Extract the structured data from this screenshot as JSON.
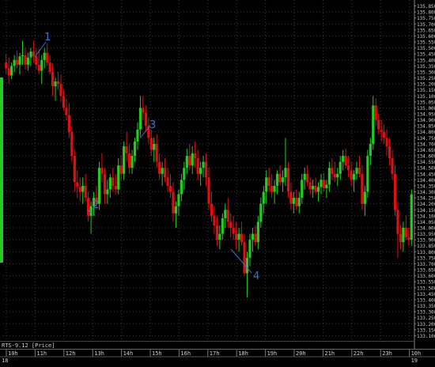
{
  "status_bar": {
    "instrument_label": "RTS-9.12 [Price]"
  },
  "colors": {
    "background": "#000000",
    "bull": "#22cc22",
    "bear": "#dd1111",
    "grid": "#3a3a3a",
    "annotation": "#3377cc",
    "text": "#d0d0d0"
  },
  "annotations": [
    {
      "text": "1"
    },
    {
      "text": "2"
    },
    {
      "text": "3"
    },
    {
      "text": "4"
    }
  ],
  "chart_data": {
    "type": "candlestick",
    "title": "",
    "series_name": "RTS-9.12 [Price]",
    "ylim": [
      133.05,
      135.9
    ],
    "y_tick_step": 0.05,
    "y_tick_labels": [
      "135.850",
      "135.800",
      "135.750",
      "135.700",
      "135.650",
      "135.600",
      "135.550",
      "135.500",
      "135.450",
      "135.400",
      "135.350",
      "135.300",
      "135.250",
      "135.200",
      "135.150",
      "135.100",
      "135.050",
      "135.000",
      "134.950",
      "134.900",
      "134.850",
      "134.800",
      "134.750",
      "134.700",
      "134.650",
      "134.600",
      "134.550",
      "134.500",
      "134.450",
      "134.400",
      "134.350",
      "134.300",
      "134.250",
      "134.200",
      "134.150",
      "134.100",
      "134.050",
      "134.000",
      "133.950",
      "133.900",
      "133.850",
      "133.800",
      "133.750",
      "133.700",
      "133.650",
      "133.600",
      "133.550",
      "133.500",
      "133.450",
      "133.400",
      "133.350",
      "133.300",
      "133.250",
      "133.200",
      "133.150",
      "133.100"
    ],
    "x_tick_labels": [
      "10h",
      "11h",
      "12h",
      "13h",
      "14h",
      "15h",
      "16h",
      "17h",
      "18h",
      "19h",
      "20h",
      "21h",
      "22h",
      "23h",
      "10h"
    ],
    "date_labels": [
      "18",
      "19"
    ],
    "grid": true,
    "candles": [
      [
        135.38,
        135.45,
        135.28,
        135.33
      ],
      [
        135.33,
        135.42,
        135.2,
        135.27
      ],
      [
        135.27,
        135.38,
        135.24,
        135.35
      ],
      [
        135.35,
        135.44,
        135.3,
        135.4
      ],
      [
        135.4,
        135.48,
        135.33,
        135.36
      ],
      [
        135.36,
        135.46,
        135.28,
        135.43
      ],
      [
        135.43,
        135.56,
        135.36,
        135.44
      ],
      [
        135.44,
        135.5,
        135.32,
        135.36
      ],
      [
        135.36,
        135.46,
        135.31,
        135.42
      ],
      [
        135.42,
        135.5,
        135.35,
        135.47
      ],
      [
        135.47,
        135.56,
        135.38,
        135.43
      ],
      [
        135.43,
        135.5,
        135.32,
        135.36
      ],
      [
        135.36,
        135.49,
        135.28,
        135.31
      ],
      [
        135.31,
        135.44,
        135.2,
        135.4
      ],
      [
        135.4,
        135.5,
        135.33,
        135.46
      ],
      [
        135.46,
        135.54,
        135.35,
        135.38
      ],
      [
        135.38,
        135.44,
        135.28,
        135.3
      ],
      [
        135.3,
        135.37,
        135.1,
        135.18
      ],
      [
        135.18,
        135.25,
        135.06,
        135.22
      ],
      [
        135.22,
        135.3,
        135.15,
        135.2
      ],
      [
        135.2,
        135.28,
        135.05,
        135.1
      ],
      [
        135.1,
        135.15,
        134.98,
        135.0
      ],
      [
        135.0,
        135.08,
        134.9,
        134.94
      ],
      [
        134.94,
        135.04,
        134.75,
        134.8
      ],
      [
        134.8,
        134.85,
        134.55,
        134.6
      ],
      [
        134.6,
        134.65,
        134.3,
        134.38
      ],
      [
        134.38,
        134.48,
        134.25,
        134.34
      ],
      [
        134.34,
        134.42,
        134.22,
        134.3
      ],
      [
        134.3,
        134.42,
        134.2,
        134.35
      ],
      [
        134.35,
        134.45,
        134.22,
        134.25
      ],
      [
        134.25,
        134.3,
        134.05,
        134.1
      ],
      [
        134.1,
        134.22,
        133.95,
        134.18
      ],
      [
        134.18,
        134.3,
        134.1,
        134.25
      ],
      [
        134.25,
        134.35,
        134.15,
        134.2
      ],
      [
        134.2,
        134.55,
        134.15,
        134.5
      ],
      [
        134.5,
        134.62,
        134.38,
        134.45
      ],
      [
        134.45,
        134.5,
        134.2,
        134.28
      ],
      [
        134.28,
        134.4,
        134.2,
        134.32
      ],
      [
        134.32,
        134.45,
        134.25,
        134.42
      ],
      [
        134.42,
        134.5,
        134.3,
        134.35
      ],
      [
        134.35,
        134.45,
        134.28,
        134.32
      ],
      [
        134.32,
        134.58,
        134.28,
        134.52
      ],
      [
        134.52,
        134.6,
        134.4,
        134.45
      ],
      [
        134.45,
        134.72,
        134.4,
        134.68
      ],
      [
        134.68,
        134.8,
        134.55,
        134.62
      ],
      [
        134.62,
        134.7,
        134.45,
        134.5
      ],
      [
        134.5,
        134.65,
        134.45,
        134.6
      ],
      [
        134.6,
        134.75,
        134.55,
        134.72
      ],
      [
        134.72,
        134.88,
        134.65,
        134.82
      ],
      [
        134.82,
        135.1,
        134.76,
        135.0
      ],
      [
        135.0,
        135.1,
        134.9,
        134.96
      ],
      [
        134.96,
        135.02,
        134.8,
        134.85
      ],
      [
        134.85,
        134.92,
        134.7,
        134.75
      ],
      [
        134.75,
        134.82,
        134.6,
        134.65
      ],
      [
        134.65,
        134.75,
        134.55,
        134.7
      ],
      [
        134.7,
        134.78,
        134.5,
        134.55
      ],
      [
        134.55,
        134.62,
        134.4,
        134.45
      ],
      [
        134.45,
        134.55,
        134.35,
        134.5
      ],
      [
        134.5,
        134.58,
        134.38,
        134.42
      ],
      [
        134.42,
        134.5,
        134.3,
        134.35
      ],
      [
        134.35,
        134.45,
        134.25,
        134.3
      ],
      [
        134.3,
        134.38,
        134.05,
        134.12
      ],
      [
        134.12,
        134.22,
        134.0,
        134.18
      ],
      [
        134.18,
        134.32,
        134.1,
        134.28
      ],
      [
        134.28,
        134.45,
        134.22,
        134.4
      ],
      [
        134.4,
        134.55,
        134.32,
        134.5
      ],
      [
        134.5,
        134.66,
        134.45,
        134.6
      ],
      [
        134.6,
        134.7,
        134.48,
        134.52
      ],
      [
        134.52,
        134.68,
        134.45,
        134.62
      ],
      [
        134.62,
        134.72,
        134.5,
        134.58
      ],
      [
        134.58,
        134.65,
        134.4,
        134.45
      ],
      [
        134.45,
        134.55,
        134.35,
        134.5
      ],
      [
        134.5,
        134.6,
        134.42,
        134.55
      ],
      [
        134.55,
        134.62,
        134.35,
        134.42
      ],
      [
        134.42,
        134.5,
        134.15,
        134.2
      ],
      [
        134.2,
        134.3,
        134.05,
        134.1
      ],
      [
        134.1,
        134.18,
        133.95,
        134.02
      ],
      [
        134.02,
        134.1,
        133.85,
        133.9
      ],
      [
        133.9,
        134.02,
        133.82,
        133.95
      ],
      [
        133.95,
        134.12,
        133.9,
        134.08
      ],
      [
        134.08,
        134.2,
        134.0,
        134.15
      ],
      [
        134.15,
        134.25,
        134.0,
        134.05
      ],
      [
        134.05,
        134.12,
        133.92,
        134.0
      ],
      [
        134.0,
        134.1,
        133.9,
        133.95
      ],
      [
        133.95,
        134.05,
        133.82,
        133.9
      ],
      [
        133.9,
        134.0,
        133.8,
        133.95
      ],
      [
        133.95,
        134.05,
        133.85,
        133.88
      ],
      [
        133.88,
        133.95,
        133.6,
        133.62
      ],
      [
        133.62,
        133.8,
        133.42,
        133.75
      ],
      [
        133.75,
        133.95,
        133.68,
        133.9
      ],
      [
        133.9,
        134.0,
        133.8,
        133.95
      ],
      [
        133.95,
        134.02,
        133.85,
        133.88
      ],
      [
        133.88,
        134.1,
        133.82,
        134.05
      ],
      [
        134.05,
        134.25,
        134.0,
        134.2
      ],
      [
        134.2,
        134.35,
        134.12,
        134.3
      ],
      [
        134.3,
        134.48,
        134.2,
        134.42
      ],
      [
        134.42,
        134.5,
        134.3,
        134.35
      ],
      [
        134.35,
        134.45,
        134.25,
        134.3
      ],
      [
        134.3,
        134.4,
        134.2,
        134.35
      ],
      [
        134.35,
        134.48,
        134.28,
        134.45
      ],
      [
        134.45,
        134.52,
        134.35,
        134.38
      ],
      [
        134.38,
        134.48,
        134.3,
        134.42
      ],
      [
        134.42,
        134.75,
        134.35,
        134.5
      ],
      [
        134.5,
        134.55,
        134.25,
        134.3
      ],
      [
        134.3,
        134.38,
        134.15,
        134.2
      ],
      [
        134.2,
        134.3,
        134.12,
        134.25
      ],
      [
        134.25,
        134.32,
        134.15,
        134.18
      ],
      [
        134.18,
        134.3,
        134.12,
        134.25
      ],
      [
        134.25,
        134.45,
        134.2,
        134.4
      ],
      [
        134.4,
        134.5,
        134.32,
        134.45
      ],
      [
        134.45,
        134.52,
        134.35,
        134.38
      ],
      [
        134.38,
        134.42,
        134.28,
        134.32
      ],
      [
        134.32,
        134.4,
        134.25,
        134.35
      ],
      [
        134.35,
        134.42,
        134.28,
        134.3
      ],
      [
        134.3,
        134.38,
        134.22,
        134.34
      ],
      [
        134.34,
        134.45,
        134.28,
        134.4
      ],
      [
        134.4,
        134.46,
        134.3,
        134.33
      ],
      [
        134.33,
        134.4,
        134.25,
        134.36
      ],
      [
        134.36,
        134.55,
        134.3,
        134.5
      ],
      [
        134.5,
        134.58,
        134.4,
        134.45
      ],
      [
        134.45,
        134.55,
        134.38,
        134.42
      ],
      [
        134.42,
        134.5,
        134.35,
        134.45
      ],
      [
        134.45,
        134.6,
        134.4,
        134.55
      ],
      [
        134.55,
        134.65,
        134.48,
        134.6
      ],
      [
        134.6,
        134.66,
        134.5,
        134.52
      ],
      [
        134.52,
        134.6,
        134.42,
        134.48
      ],
      [
        134.48,
        134.55,
        134.35,
        134.4
      ],
      [
        134.4,
        134.48,
        134.3,
        134.45
      ],
      [
        134.45,
        134.55,
        134.4,
        134.5
      ],
      [
        134.5,
        134.6,
        134.42,
        134.45
      ],
      [
        134.45,
        134.52,
        134.15,
        134.2
      ],
      [
        134.2,
        134.35,
        134.1,
        134.3
      ],
      [
        134.3,
        134.65,
        134.25,
        134.6
      ],
      [
        134.6,
        134.75,
        134.52,
        134.7
      ],
      [
        134.7,
        135.1,
        134.65,
        135.02
      ],
      [
        135.02,
        135.08,
        134.85,
        134.9
      ],
      [
        134.9,
        134.95,
        134.78,
        134.82
      ],
      [
        134.82,
        134.9,
        134.72,
        134.8
      ],
      [
        134.8,
        134.86,
        134.7,
        134.75
      ],
      [
        134.75,
        134.82,
        134.6,
        134.68
      ],
      [
        134.68,
        134.75,
        134.52,
        134.58
      ],
      [
        134.58,
        134.65,
        134.4,
        134.45
      ],
      [
        134.45,
        134.52,
        134.1,
        134.15
      ],
      [
        134.15,
        134.22,
        133.75,
        133.95
      ],
      [
        133.95,
        134.02,
        133.82,
        133.88
      ],
      [
        133.88,
        134.05,
        133.8,
        134.0
      ],
      [
        134.0,
        134.1,
        133.9,
        133.92
      ],
      [
        133.92,
        134.0,
        133.85,
        133.9
      ],
      [
        133.9,
        134.32,
        133.85,
        134.28
      ]
    ]
  }
}
